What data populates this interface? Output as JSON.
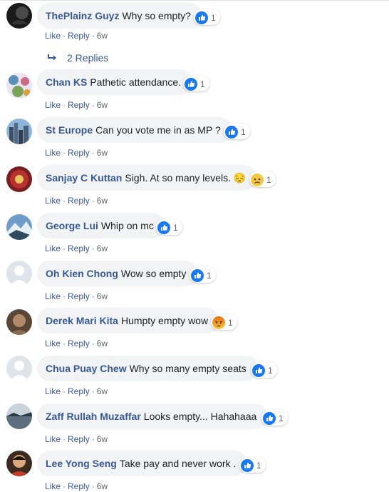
{
  "comments": [
    {
      "author": "ThePlainz Guyz",
      "text": "Why so empty?",
      "count": "1",
      "reaction": "like",
      "avatar": "dark",
      "has_replies": true
    },
    {
      "author": "Chan KS",
      "text": "Pathetic attendance.",
      "count": "1",
      "reaction": "like",
      "avatar": "pattern"
    },
    {
      "author": "St Europe",
      "text": "Can you vote me in as MP ?",
      "count": "1",
      "reaction": "like",
      "avatar": "city"
    },
    {
      "author": "Sanjay C Kuttan",
      "text": "Sigh. At so many levels. 😔",
      "count": "1",
      "reaction": "sad",
      "avatar": "red"
    },
    {
      "author": "George Lui",
      "text": "Whip on mc",
      "count": "1",
      "reaction": "like",
      "avatar": "mountain"
    },
    {
      "author": "Oh Kien Chong",
      "text": "Wow so empty",
      "count": "1",
      "reaction": "like",
      "avatar": "default"
    },
    {
      "author": "Derek Mari Kita",
      "text": "Humpty empty wow",
      "count": "1",
      "reaction": "angry",
      "avatar": "brown"
    },
    {
      "author": "Chua Puay Chew",
      "text": "Why so many empty seats",
      "count": "1",
      "reaction": "like",
      "avatar": "default"
    },
    {
      "author": "Zaff Rullah Muzaffar",
      "text": "Looks empty... Hahahaaa",
      "count": "1",
      "reaction": "like",
      "avatar": "lake"
    },
    {
      "author": "Lee Yong Seng",
      "text": "Take pay and never work .",
      "count": "1",
      "reaction": "like",
      "avatar": "man"
    }
  ],
  "actions": {
    "like": "Like",
    "reply": "Reply",
    "separator": "·",
    "time": "6w"
  },
  "replies_link": "2 Replies",
  "colors": {
    "link": "#385898",
    "bubble": "#f2f3f5",
    "like_blue": "#1877f2",
    "meta": "#606770"
  }
}
